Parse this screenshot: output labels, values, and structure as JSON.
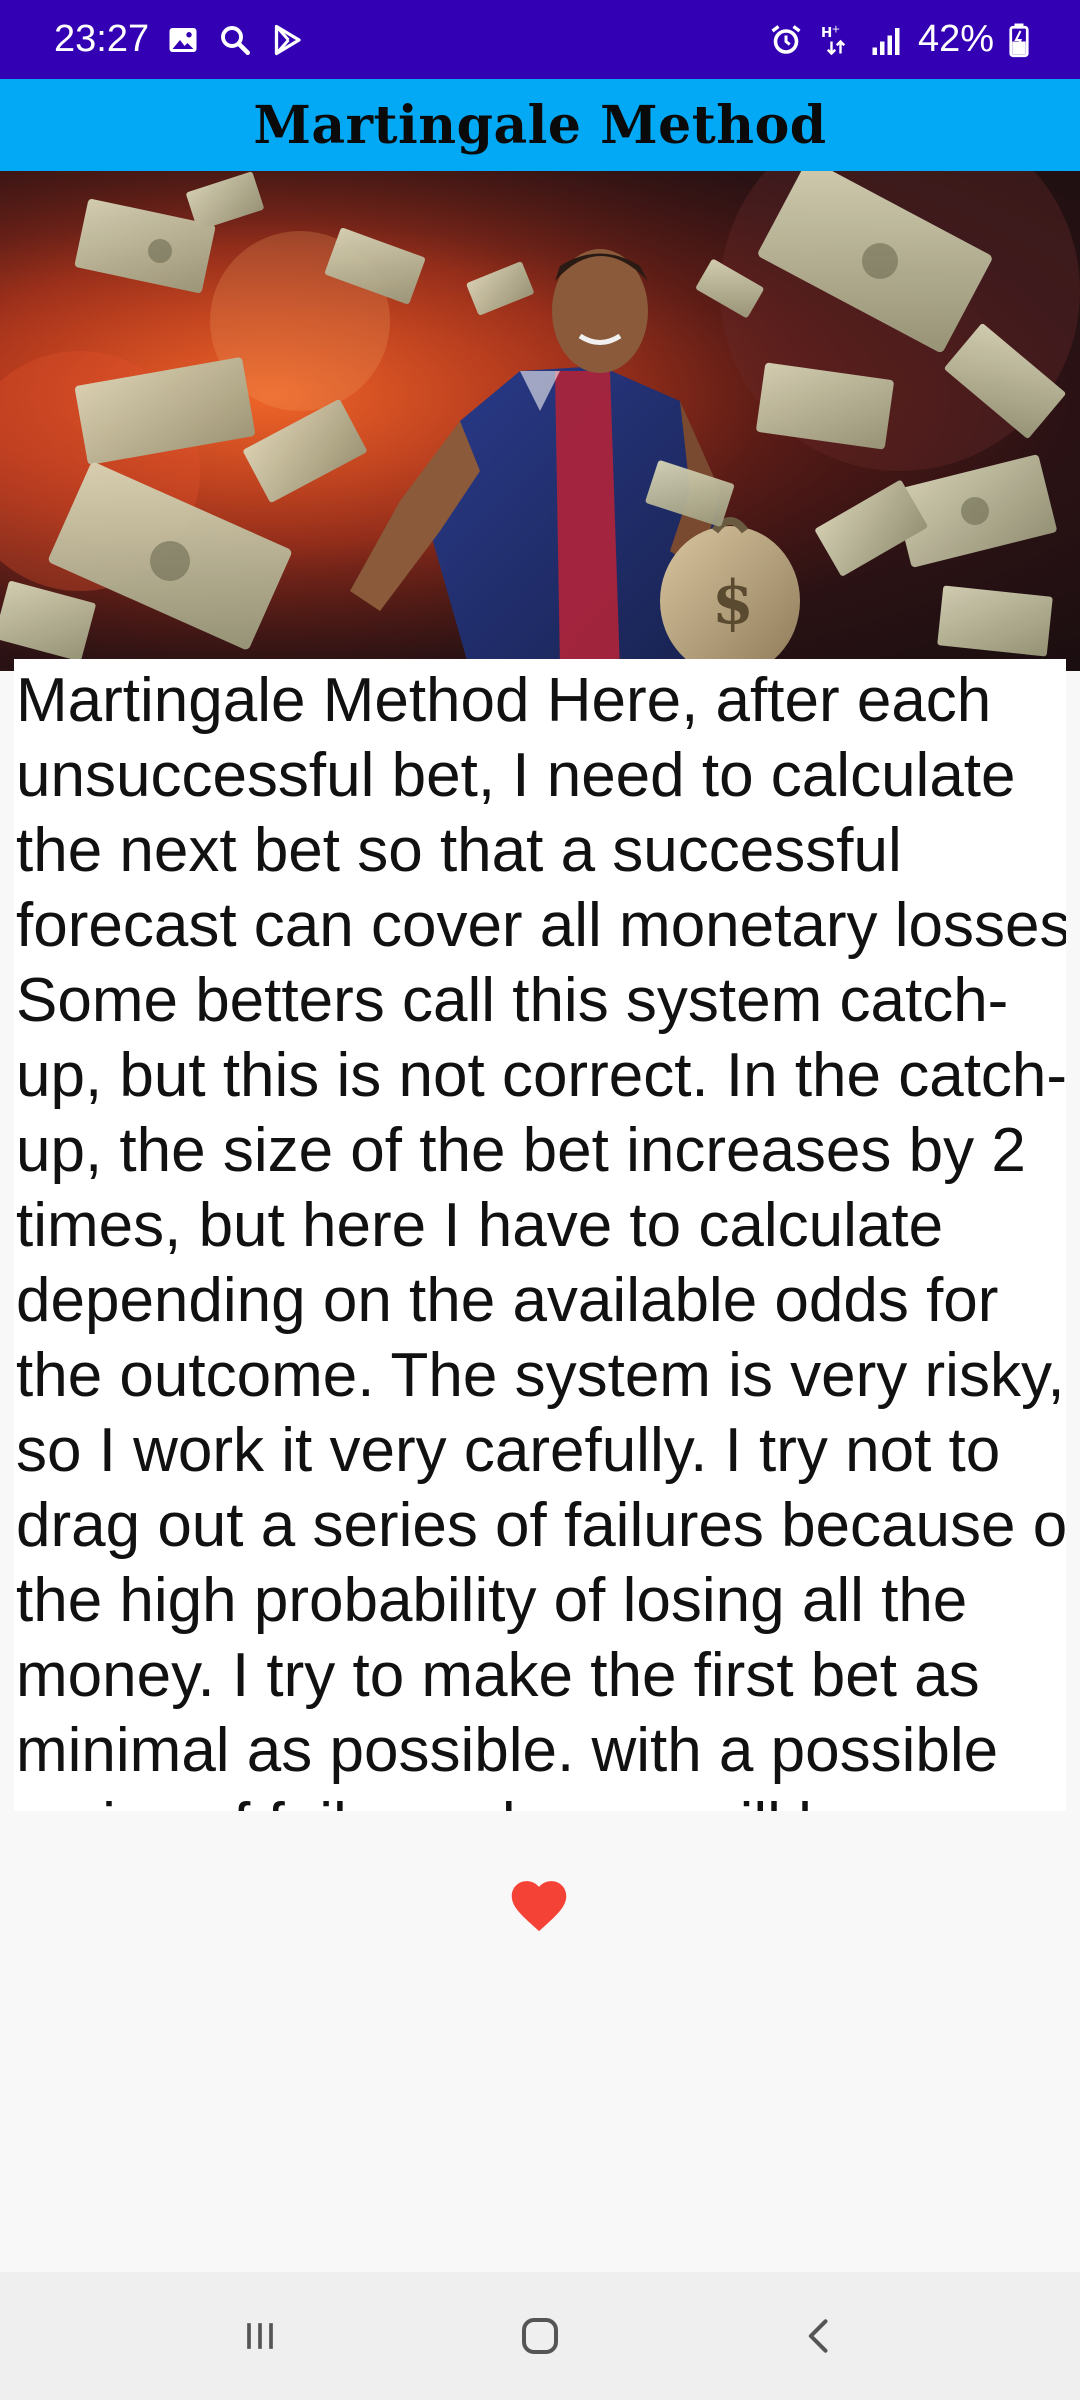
{
  "status_bar": {
    "time": "23:27",
    "battery": "42%",
    "left_icons": [
      "gallery-icon",
      "search-icon",
      "play-store-icon"
    ],
    "right_icons": [
      "alarm-icon",
      "data-arrows-icon",
      "signal-icon",
      "battery-icon"
    ]
  },
  "app_bar": {
    "title": "Martingale Method"
  },
  "article": {
    "text": "Martingale Method Here, after each unsuccessful bet, I need to calculate the next bet so that a successful forecast can cover all monetary losses. Some betters call this system catch-up, but this is not correct. In the catch-up, the size of the bet increases by 2 times, but here I have to calculate depending on the available odds for the outcome. The system is very risky, so I work it very carefully. I try not to drag out a series of failures because of the high probability of losing all the money. I try to make the first bet as minimal as possible. with a possible series of failures, losses will be"
  },
  "colors": {
    "status_bar": "#3300b3",
    "app_bar": "#03a9f4",
    "heart": "#f44336",
    "background": "#f8f8f8"
  },
  "nav_bar": {
    "buttons": [
      "recent-apps-icon",
      "home-icon",
      "back-icon"
    ]
  }
}
